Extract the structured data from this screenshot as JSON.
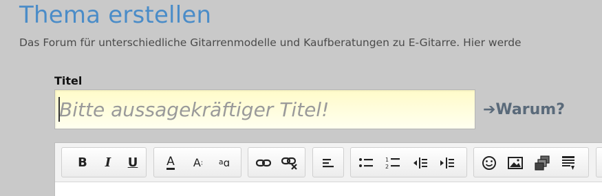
{
  "page": {
    "title": "Thema erstellen",
    "description": "Das Forum für unterschiedliche Gitarrenmodelle und Kaufberatungen zu E-Gitarre. Hier werde"
  },
  "form": {
    "title_label": "Titel",
    "title_value": "",
    "title_placeholder": "Bitte aussagekräftiger Titel!",
    "why_link": "➔Warum?"
  },
  "toolbar": {
    "bold_label": "B",
    "italic_label": "I",
    "underline_label": "U",
    "text_color_label": "A",
    "font_size_label": "A",
    "font_family_label": "a",
    "icons": [
      "bold-icon",
      "italic-icon",
      "underline-icon",
      "text-color-icon",
      "font-size-icon",
      "font-family-icon",
      "link-icon",
      "unlink-icon",
      "align-icon",
      "bulleted-list-icon",
      "numbered-list-icon",
      "outdent-icon",
      "indent-icon",
      "smiley-icon",
      "image-icon",
      "media-icon",
      "template-icon"
    ]
  },
  "colors": {
    "title": "#4a8cc8",
    "background": "#c9c9c9",
    "input_bg": "#fffbc9",
    "why_link": "#5a6a7a"
  }
}
